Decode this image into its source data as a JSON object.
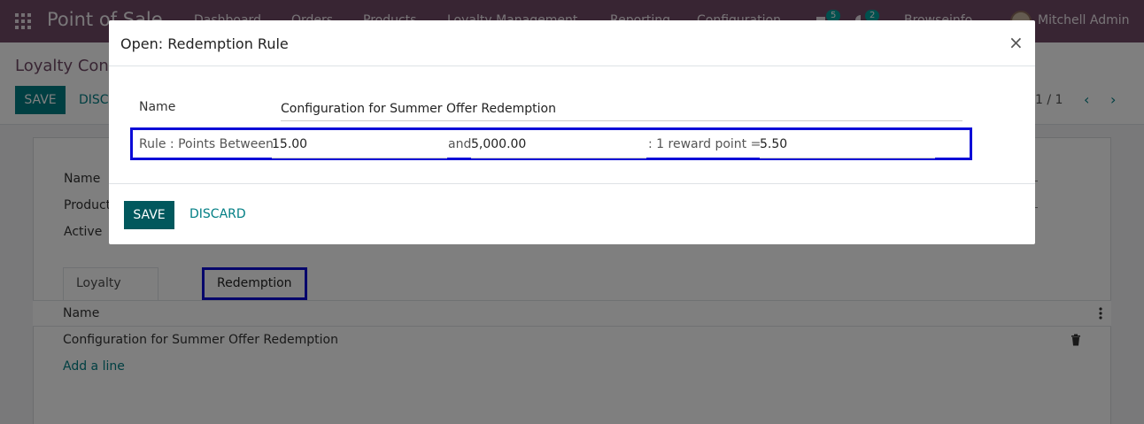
{
  "navbar": {
    "brand": "Point of Sale",
    "menu": [
      "Dashboard",
      "Orders",
      "Products",
      "Loyalty Management",
      "Reporting",
      "Configuration"
    ],
    "badges": [
      "5",
      "2"
    ],
    "extra_menu": "Browseinfo",
    "user": "Mitchell Admin"
  },
  "control": {
    "title": "Loyalty Con",
    "save_label": "SAVE",
    "discard_label": "DISC",
    "pager": "1 / 1"
  },
  "form": {
    "labels": [
      "Name",
      "Product",
      "Active"
    ],
    "tabs": [
      "Loyalty Calculation",
      "Redemption Rule"
    ],
    "list_header": "Name",
    "rows": [
      "Configuration for Summer Offer Redemption"
    ],
    "add_line": "Add a line"
  },
  "modal": {
    "title": "Open: Redemption Rule",
    "close": "×",
    "name_label": "Name",
    "name_value": "Configuration for Summer Offer Redemption",
    "rule_label": "Rule : Points Between",
    "min_points": "15.00",
    "and_text": "and",
    "max_points": "5,000.00",
    "reward_text": ": 1 reward point =",
    "reward_value": "5.50",
    "save_label": "SAVE",
    "discard_label": "DISCARD"
  },
  "colors": {
    "navbar": "#714b67",
    "primary": "#017e84",
    "highlight": "#0c0cd7"
  }
}
